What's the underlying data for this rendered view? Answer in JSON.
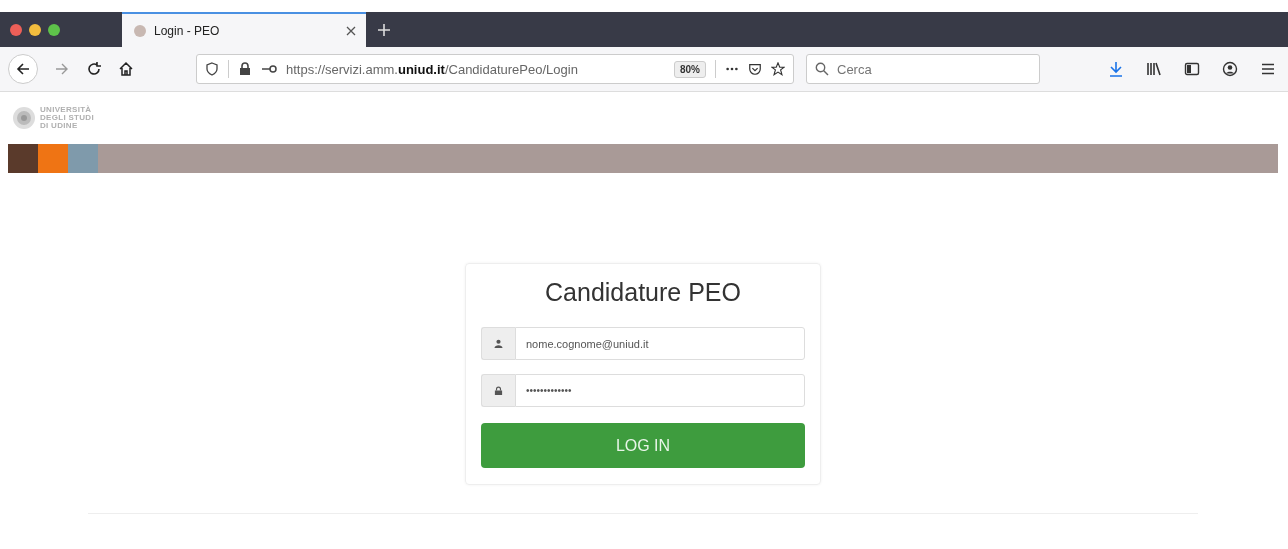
{
  "browser": {
    "tabs": [
      {
        "title": "Login - PEO",
        "selected": true
      }
    ],
    "url": {
      "prefix": "https://servizi.amm.",
      "domain": "uniud.it",
      "path": "/CandidaturePeo/Login"
    },
    "zoom": "80%",
    "search": {
      "placeholder": "Cerca"
    }
  },
  "logo": {
    "lines": [
      "UNIVERSITÀ",
      "DEGLI STUDI",
      "DI UDINE"
    ]
  },
  "login": {
    "title": "Candidature PEO",
    "username": "nome.cognome@uniud.it",
    "password": "•••••••••••••",
    "button": "LOG IN"
  }
}
